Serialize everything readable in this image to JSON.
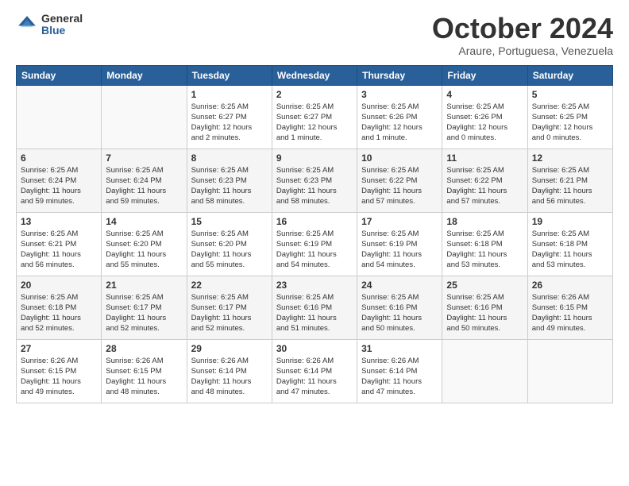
{
  "logo": {
    "general": "General",
    "blue": "Blue"
  },
  "title": {
    "month": "October 2024",
    "location": "Araure, Portuguesa, Venezuela"
  },
  "days_of_week": [
    "Sunday",
    "Monday",
    "Tuesday",
    "Wednesday",
    "Thursday",
    "Friday",
    "Saturday"
  ],
  "weeks": [
    [
      {
        "day": "",
        "info": ""
      },
      {
        "day": "",
        "info": ""
      },
      {
        "day": "1",
        "info": "Sunrise: 6:25 AM\nSunset: 6:27 PM\nDaylight: 12 hours\nand 2 minutes."
      },
      {
        "day": "2",
        "info": "Sunrise: 6:25 AM\nSunset: 6:27 PM\nDaylight: 12 hours\nand 1 minute."
      },
      {
        "day": "3",
        "info": "Sunrise: 6:25 AM\nSunset: 6:26 PM\nDaylight: 12 hours\nand 1 minute."
      },
      {
        "day": "4",
        "info": "Sunrise: 6:25 AM\nSunset: 6:26 PM\nDaylight: 12 hours\nand 0 minutes."
      },
      {
        "day": "5",
        "info": "Sunrise: 6:25 AM\nSunset: 6:25 PM\nDaylight: 12 hours\nand 0 minutes."
      }
    ],
    [
      {
        "day": "6",
        "info": "Sunrise: 6:25 AM\nSunset: 6:24 PM\nDaylight: 11 hours\nand 59 minutes."
      },
      {
        "day": "7",
        "info": "Sunrise: 6:25 AM\nSunset: 6:24 PM\nDaylight: 11 hours\nand 59 minutes."
      },
      {
        "day": "8",
        "info": "Sunrise: 6:25 AM\nSunset: 6:23 PM\nDaylight: 11 hours\nand 58 minutes."
      },
      {
        "day": "9",
        "info": "Sunrise: 6:25 AM\nSunset: 6:23 PM\nDaylight: 11 hours\nand 58 minutes."
      },
      {
        "day": "10",
        "info": "Sunrise: 6:25 AM\nSunset: 6:22 PM\nDaylight: 11 hours\nand 57 minutes."
      },
      {
        "day": "11",
        "info": "Sunrise: 6:25 AM\nSunset: 6:22 PM\nDaylight: 11 hours\nand 57 minutes."
      },
      {
        "day": "12",
        "info": "Sunrise: 6:25 AM\nSunset: 6:21 PM\nDaylight: 11 hours\nand 56 minutes."
      }
    ],
    [
      {
        "day": "13",
        "info": "Sunrise: 6:25 AM\nSunset: 6:21 PM\nDaylight: 11 hours\nand 56 minutes."
      },
      {
        "day": "14",
        "info": "Sunrise: 6:25 AM\nSunset: 6:20 PM\nDaylight: 11 hours\nand 55 minutes."
      },
      {
        "day": "15",
        "info": "Sunrise: 6:25 AM\nSunset: 6:20 PM\nDaylight: 11 hours\nand 55 minutes."
      },
      {
        "day": "16",
        "info": "Sunrise: 6:25 AM\nSunset: 6:19 PM\nDaylight: 11 hours\nand 54 minutes."
      },
      {
        "day": "17",
        "info": "Sunrise: 6:25 AM\nSunset: 6:19 PM\nDaylight: 11 hours\nand 54 minutes."
      },
      {
        "day": "18",
        "info": "Sunrise: 6:25 AM\nSunset: 6:18 PM\nDaylight: 11 hours\nand 53 minutes."
      },
      {
        "day": "19",
        "info": "Sunrise: 6:25 AM\nSunset: 6:18 PM\nDaylight: 11 hours\nand 53 minutes."
      }
    ],
    [
      {
        "day": "20",
        "info": "Sunrise: 6:25 AM\nSunset: 6:18 PM\nDaylight: 11 hours\nand 52 minutes."
      },
      {
        "day": "21",
        "info": "Sunrise: 6:25 AM\nSunset: 6:17 PM\nDaylight: 11 hours\nand 52 minutes."
      },
      {
        "day": "22",
        "info": "Sunrise: 6:25 AM\nSunset: 6:17 PM\nDaylight: 11 hours\nand 52 minutes."
      },
      {
        "day": "23",
        "info": "Sunrise: 6:25 AM\nSunset: 6:16 PM\nDaylight: 11 hours\nand 51 minutes."
      },
      {
        "day": "24",
        "info": "Sunrise: 6:25 AM\nSunset: 6:16 PM\nDaylight: 11 hours\nand 50 minutes."
      },
      {
        "day": "25",
        "info": "Sunrise: 6:25 AM\nSunset: 6:16 PM\nDaylight: 11 hours\nand 50 minutes."
      },
      {
        "day": "26",
        "info": "Sunrise: 6:26 AM\nSunset: 6:15 PM\nDaylight: 11 hours\nand 49 minutes."
      }
    ],
    [
      {
        "day": "27",
        "info": "Sunrise: 6:26 AM\nSunset: 6:15 PM\nDaylight: 11 hours\nand 49 minutes."
      },
      {
        "day": "28",
        "info": "Sunrise: 6:26 AM\nSunset: 6:15 PM\nDaylight: 11 hours\nand 48 minutes."
      },
      {
        "day": "29",
        "info": "Sunrise: 6:26 AM\nSunset: 6:14 PM\nDaylight: 11 hours\nand 48 minutes."
      },
      {
        "day": "30",
        "info": "Sunrise: 6:26 AM\nSunset: 6:14 PM\nDaylight: 11 hours\nand 47 minutes."
      },
      {
        "day": "31",
        "info": "Sunrise: 6:26 AM\nSunset: 6:14 PM\nDaylight: 11 hours\nand 47 minutes."
      },
      {
        "day": "",
        "info": ""
      },
      {
        "day": "",
        "info": ""
      }
    ]
  ]
}
